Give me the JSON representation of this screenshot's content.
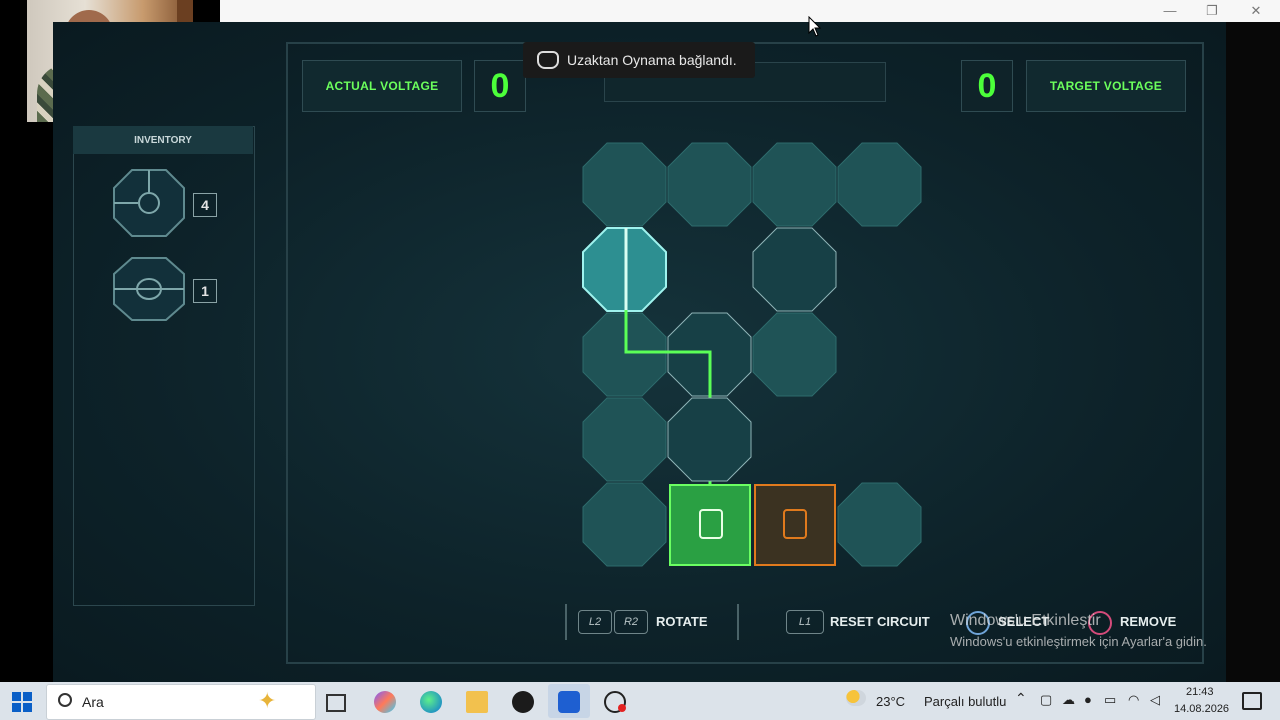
{
  "window": {
    "controls": [
      "—",
      "❐",
      "✕"
    ]
  },
  "game": {
    "actual_voltage_label": "ACTUAL VOLTAGE",
    "actual_voltage_value": "0",
    "target_voltage_label": "TARGET VOLTAGE",
    "target_voltage_value": "0",
    "inventory_title": "INVENTORY",
    "inventory_counts": [
      "4",
      "1"
    ],
    "controls": {
      "l2": "L2",
      "r2": "R2",
      "rotate": "ROTATE",
      "l1": "L1",
      "reset": "RESET CIRCUIT",
      "select": "SELECT",
      "remove": "REMOVE"
    },
    "colors": {
      "accent_green": "#4cff3a",
      "accent_orange": "#e07a1d",
      "tile_teal": "#2f8f8a"
    }
  },
  "toast": {
    "text": "Uzaktan Oynama bağlandı.",
    "icon": "gamepad-icon"
  },
  "watermark": {
    "title": "Windows'u Etkinleştir",
    "subtitle": "Windows'u etkinleştirmek için Ayarlar'a gidin."
  },
  "taskbar": {
    "search_placeholder": "Ara",
    "weather_temp": "23°C",
    "weather_desc": "Parçalı bulutlu",
    "time": "21:43",
    "date": "14.08.2026"
  }
}
